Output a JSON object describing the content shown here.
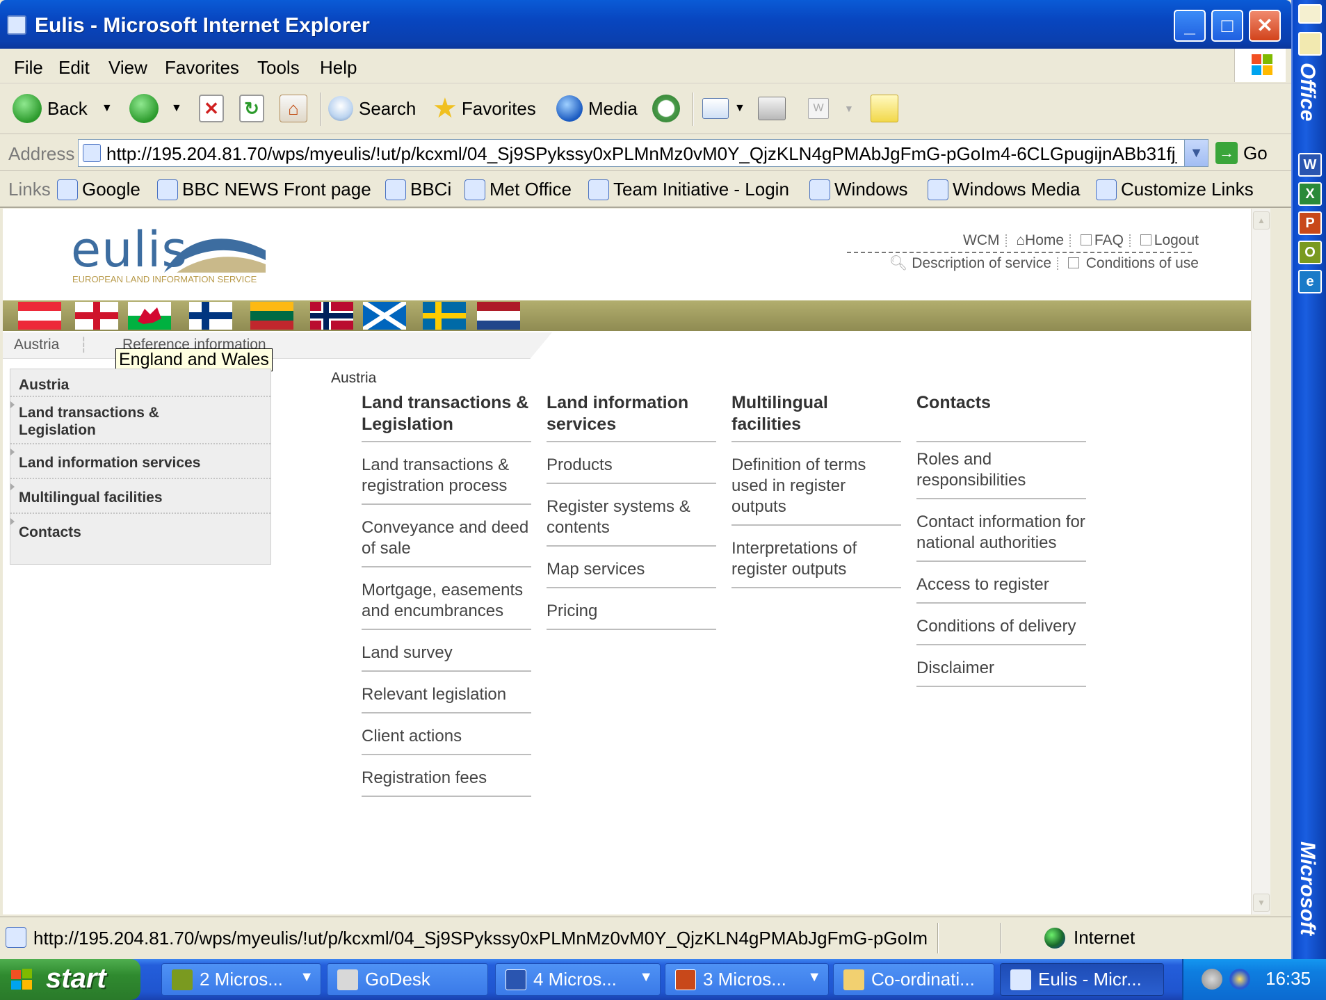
{
  "window": {
    "title": "Eulis - Microsoft Internet Explorer",
    "min_label": "_",
    "max_label": "□",
    "close_label": "✕"
  },
  "menu": [
    "File",
    "Edit",
    "View",
    "Favorites",
    "Tools",
    "Help"
  ],
  "toolbar": {
    "back": "Back",
    "search": "Search",
    "favorites": "Favorites",
    "media": "Media"
  },
  "address": {
    "label": "Address",
    "url": "http://195.204.81.70/wps/myeulis/!ut/p/kcxml/04_Sj9SPykssy0xPLMnMz0vM0Y_QjzKLN4gPMAbJgFmG-pGoIm4-6CLGpugijnABb31fj_",
    "go": "Go"
  },
  "links": {
    "label": "Links",
    "items": [
      "Google",
      "BBC NEWS Front page",
      "BBCi",
      "Met Office",
      "Team Initiative - Login",
      "Windows",
      "Windows Media",
      "Customize Links"
    ]
  },
  "page": {
    "logo": "eulis",
    "logo_sub": "EUROPEAN LAND INFORMATION SERVICE",
    "top_links": [
      "WCM",
      "Home",
      "FAQ",
      "Logout"
    ],
    "top_links2": [
      "Description of service",
      "Conditions of use"
    ],
    "flags": [
      "Austria",
      "England",
      "Wales",
      "Finland",
      "Lithuania",
      "Norway",
      "Scotland",
      "Sweden",
      "Netherlands"
    ],
    "breadcrumb": [
      "Austria",
      "Reference information"
    ],
    "tooltip": "England and Wales",
    "left_nav": [
      "Austria",
      "Land transactions & Legislation",
      "Land information services",
      "Multilingual facilities",
      "Contacts"
    ],
    "content_title": "Austria",
    "columns": [
      {
        "heading": "Land transactions & Legislation",
        "links": [
          "Land transactions & registration process",
          "Conveyance and deed of sale",
          "Mortgage, easements and encumbrances",
          "Land survey",
          "Relevant legislation",
          "Client actions",
          "Registration fees"
        ]
      },
      {
        "heading": "Land information services",
        "links": [
          "Products",
          "Register systems & contents",
          "Map services",
          "Pricing"
        ]
      },
      {
        "heading": "Multilingual facilities",
        "links": [
          "Definition of terms used in register outputs",
          "Interpretations of register outputs"
        ]
      },
      {
        "heading": "Contacts",
        "links": [
          "Roles and responsibilities",
          "Contact information for national authorities",
          "Access to register",
          "Conditions of delivery",
          "Disclaimer"
        ]
      }
    ]
  },
  "status": {
    "url": "http://195.204.81.70/wps/myeulis/!ut/p/kcxml/04_Sj9SPykssy0xPLMnMz0vM0Y_QjzKLN4gPMAbJgFmG-pGoIm",
    "zone": "Internet"
  },
  "officebar": {
    "top_text": "Office",
    "bottom_text": "Microsoft"
  },
  "taskbar": {
    "start": "start",
    "tasks": [
      "2 Micros...",
      "GoDesk",
      "4 Micros...",
      "3 Micros...",
      "Co-ordinati...",
      "Eulis - Micr..."
    ],
    "clock": "16:35"
  },
  "colors": {
    "title_blue": "#0a4fc8",
    "taskbar_blue": "#245edb",
    "start_green": "#2f8a2f",
    "flag_bar": "#a09c60",
    "logo_blue": "#3d6da0"
  }
}
